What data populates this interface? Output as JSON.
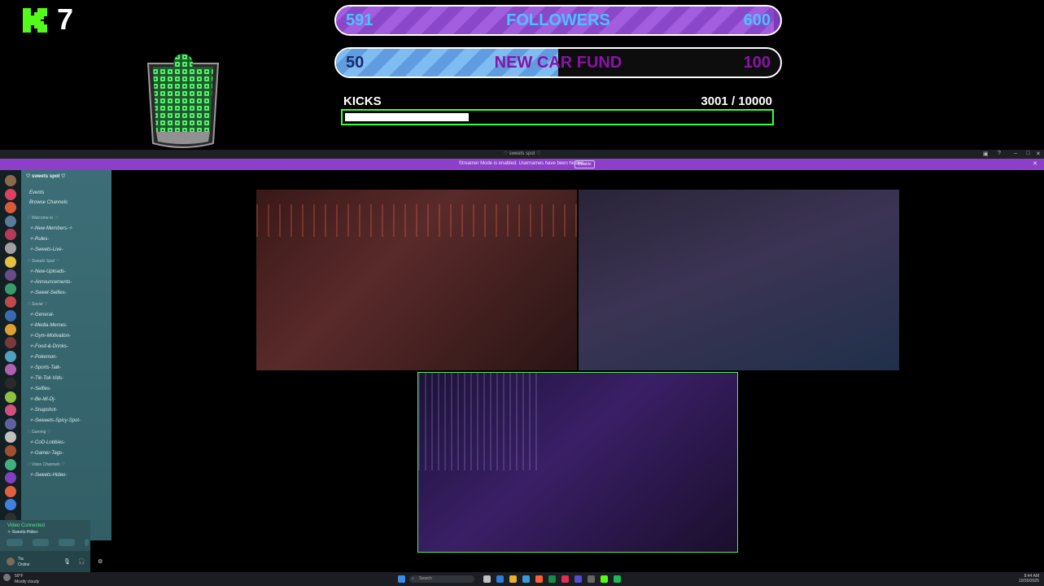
{
  "overlay": {
    "kick_count": "7",
    "goals": [
      {
        "start": "591",
        "label": "FOLLOWERS",
        "end": "600",
        "progress": 0.985
      },
      {
        "start": "50",
        "label": "NEW CAR FUND",
        "end": "100",
        "progress": 0.5
      }
    ],
    "kicks": {
      "label": "KICKS",
      "current": "3001",
      "total": "/ 10000",
      "progress": 0.3001
    }
  },
  "discord": {
    "window_title": "♡ sweets spot ♡",
    "banner_text": "Streamer Mode is enabled. Usernames have been hidden.",
    "banner_button": "Disable",
    "guild_name": "♡ sweets spot ♡",
    "top_items": [
      "Events",
      "Browse Channels"
    ],
    "categories": [
      {
        "name": "♡ Welcome to ♡",
        "channels": [
          "✧-New-Members-✧",
          "✧-Rules-",
          "✧-Sweets-Live-"
        ]
      },
      {
        "name": "♡ Sweets Spot ♡",
        "channels": [
          "✧-New-Uploads-",
          "✧-Announcements-",
          "✧-Sweet-Selfies-"
        ]
      },
      {
        "name": "♡ Social ♡",
        "channels": [
          "✧-General-",
          "✧-Media-Memes-",
          "✧-Gym-Motivation-",
          "✧-Food-&-Drinks-",
          "✧-Pokemon-",
          "✧-Sports-Talk-",
          "✧-Tik-Tok-Vids-",
          "✧-Selfies-",
          "✧-Be-Mi-Dj-",
          "✧-Snapshot-",
          "✧-Sweeets-Spicy-Spot-"
        ]
      },
      {
        "name": "♡ Gaming ♡",
        "channels": [
          "✧-CoD-Lobbies-",
          "✧-Gamer-Tags-"
        ]
      },
      {
        "name": "♡ Voice Channels ♡",
        "channels": [
          "✧-Sweets-Hideo-"
        ]
      }
    ],
    "voice_status": "Video Connected",
    "voice_channel": "✧-Sweets-Hideo-",
    "user_name": "Tia",
    "user_status": "Online"
  },
  "taskbar": {
    "weather_temp": "59°F",
    "weather_desc": "Mostly cloudy",
    "search_placeholder": "Search",
    "time": "8:44 AM",
    "date": "10/30/2025"
  },
  "colors": {
    "kick_green": "#53fc18",
    "followers_bg": "#7b3bb6",
    "followers_text": "#47c4ff",
    "carfund_fill": "#7fbcf2",
    "carfund_text": "#8a12a8",
    "kicks_border": "#3aff2f",
    "discord_banner": "#8d3fc9"
  },
  "icons": [
    "kick-logo-icon",
    "jar-icon",
    "search-icon",
    "windows-icon",
    "close-icon",
    "minimize-icon",
    "maximize-icon",
    "mic-icon",
    "headphones-icon",
    "settings-icon"
  ]
}
